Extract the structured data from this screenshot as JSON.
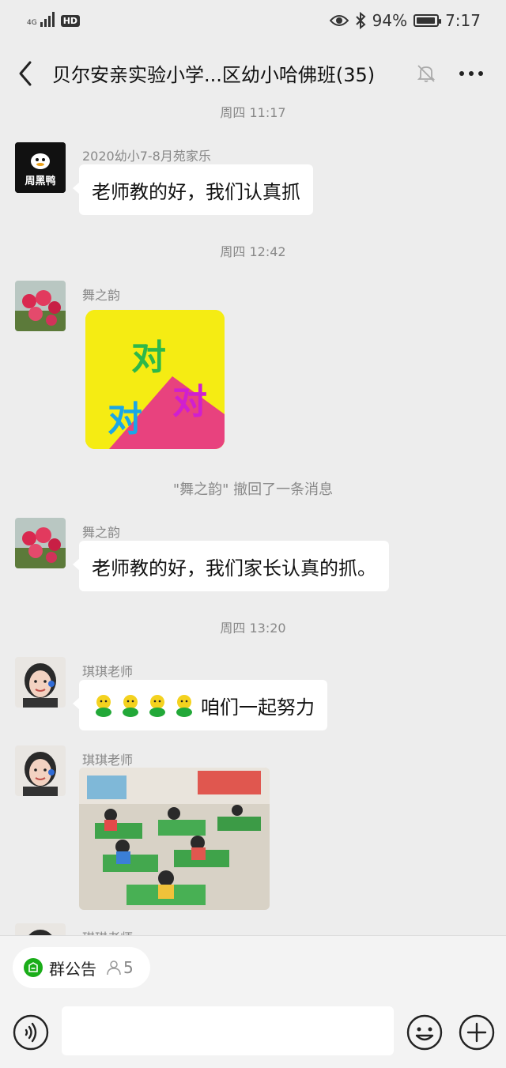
{
  "status": {
    "network": "4G",
    "hd_label": "HD",
    "battery_percent": "94%",
    "battery_level": 0.94,
    "time": "7:17"
  },
  "header": {
    "title": "贝尔安亲实验小学...区幼小哈佛班(35)"
  },
  "messages": [
    {
      "type": "time",
      "text": "周四 11:17"
    },
    {
      "type": "text",
      "sender": "2020幼小7-8月苑家乐",
      "avatar_caption": "周黑鸭",
      "text": "老师教的好，我们认真抓"
    },
    {
      "type": "time",
      "text": "周四 12:42"
    },
    {
      "type": "sticker",
      "sender": "舞之韵",
      "sticker_chars": [
        "对",
        "对",
        "对"
      ]
    },
    {
      "type": "recall",
      "text": "\"舞之韵\" 撤回了一条消息"
    },
    {
      "type": "text",
      "sender": "舞之韵",
      "text": "老师教的好，我们家长认真的抓。"
    },
    {
      "type": "time",
      "text": "周四 13:20"
    },
    {
      "type": "text",
      "sender": "琪琪老师",
      "text": "咱们一起努力",
      "emoji_count": 4
    },
    {
      "type": "image",
      "sender": "琪琪老师"
    },
    {
      "type": "partial",
      "sender": "琪琪老师"
    }
  ],
  "group_notice": {
    "label": "群公告",
    "member_count": "5"
  },
  "input": {
    "placeholder": ""
  },
  "colors": {
    "background": "#ededed",
    "bubble": "#ffffff",
    "notice_green": "#1aad19",
    "sticker_yellow": "#f5ec13",
    "sticker_pink": "#e8427e"
  }
}
